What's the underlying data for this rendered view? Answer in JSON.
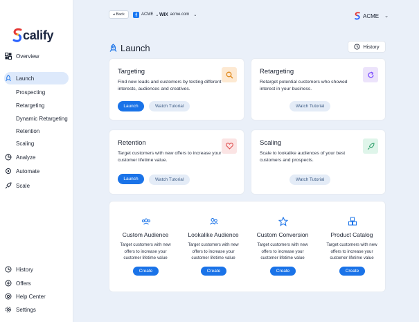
{
  "brand": {
    "name": "calify",
    "accent": "#1a73e8"
  },
  "nav": {
    "overview": "Overview",
    "launch": "Launch",
    "sub": [
      "Prospecting",
      "Retargeting",
      "Dynamic Retargeting",
      "Retention",
      "Scaling"
    ],
    "analyze": "Analyze",
    "automate": "Automate",
    "scale": "Scale",
    "history": "History",
    "offers": "Offers",
    "help": "Help Center",
    "settings": "Settings"
  },
  "topbar": {
    "back": "Back",
    "fb_account": "ACME",
    "wix_label": "WIX",
    "wix_account": "acme.com",
    "brand_select": "ACME"
  },
  "page": {
    "title": "Launch",
    "history_button": "History"
  },
  "cards": {
    "targeting": {
      "title": "Targeting",
      "desc": "Find new leads and customers by testing different interests, audiences and creatives.",
      "primary": "Launch",
      "ghost": "Watch Tutorial"
    },
    "retargeting": {
      "title": "Retargeting",
      "desc": "Retarget potential customers who showed interest in your business.",
      "ghost": "Watch Tutorial"
    },
    "retention": {
      "title": "Retention",
      "desc": "Target customers with new offers to increase your customer lifetime value.",
      "primary": "Launch",
      "ghost": "Watch Tutorial"
    },
    "scaling": {
      "title": "Scaling",
      "desc": "Scale to lookalike audiences of your best customers and prospects.",
      "ghost": "Watch Tutorial"
    }
  },
  "create_items": [
    {
      "title": "Custom Audience",
      "desc": "Target customers with new offers to increase your customer lifetime value",
      "button": "Create",
      "icon": "people-icon"
    },
    {
      "title": "Lookalike Audience",
      "desc": "Target customers with new offers to increase your customer lifetime value",
      "button": "Create",
      "icon": "user-pair-icon"
    },
    {
      "title": "Custom Conversion",
      "desc": "Target customers with new offers to increase your customer lifetime value",
      "button": "Create",
      "icon": "star-icon"
    },
    {
      "title": "Product Catalog",
      "desc": "Target customers with new offers to increase your customer lifetime value",
      "button": "Create",
      "icon": "boxes-icon"
    }
  ]
}
